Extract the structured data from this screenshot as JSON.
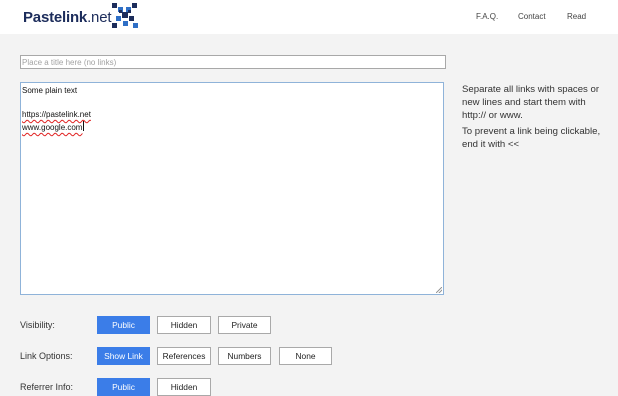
{
  "header": {
    "logo_name": "Pastelink",
    "logo_suffix": ".net",
    "nav": [
      {
        "label": "F.A.Q."
      },
      {
        "label": "Contact"
      },
      {
        "label": "Read"
      }
    ]
  },
  "form": {
    "title_placeholder": "Place a title here (no links)",
    "title_value": "",
    "body_lines": [
      "Some plain text",
      "",
      "https://pastelink.net",
      "www.google.com"
    ]
  },
  "help": {
    "text1": "Separate all links with spaces or new lines and start them with http:// or www.",
    "text2": "To prevent a link being clickable, end it with <<"
  },
  "options": {
    "visibility": {
      "label": "Visibility:",
      "choices": [
        "Public",
        "Hidden",
        "Private"
      ],
      "selected": "Public"
    },
    "link_options": {
      "label": "Link Options:",
      "choices": [
        "Show Link",
        "References",
        "Numbers",
        "None"
      ],
      "selected": "Show Link"
    },
    "referrer_info": {
      "label": "Referrer Info:",
      "choices": [
        "Public",
        "Hidden"
      ],
      "selected": "Public"
    }
  },
  "colors": {
    "accent": "#3b7de8",
    "brand_dark": "#1c2c5b",
    "brand_blue": "#2f6fc6"
  }
}
